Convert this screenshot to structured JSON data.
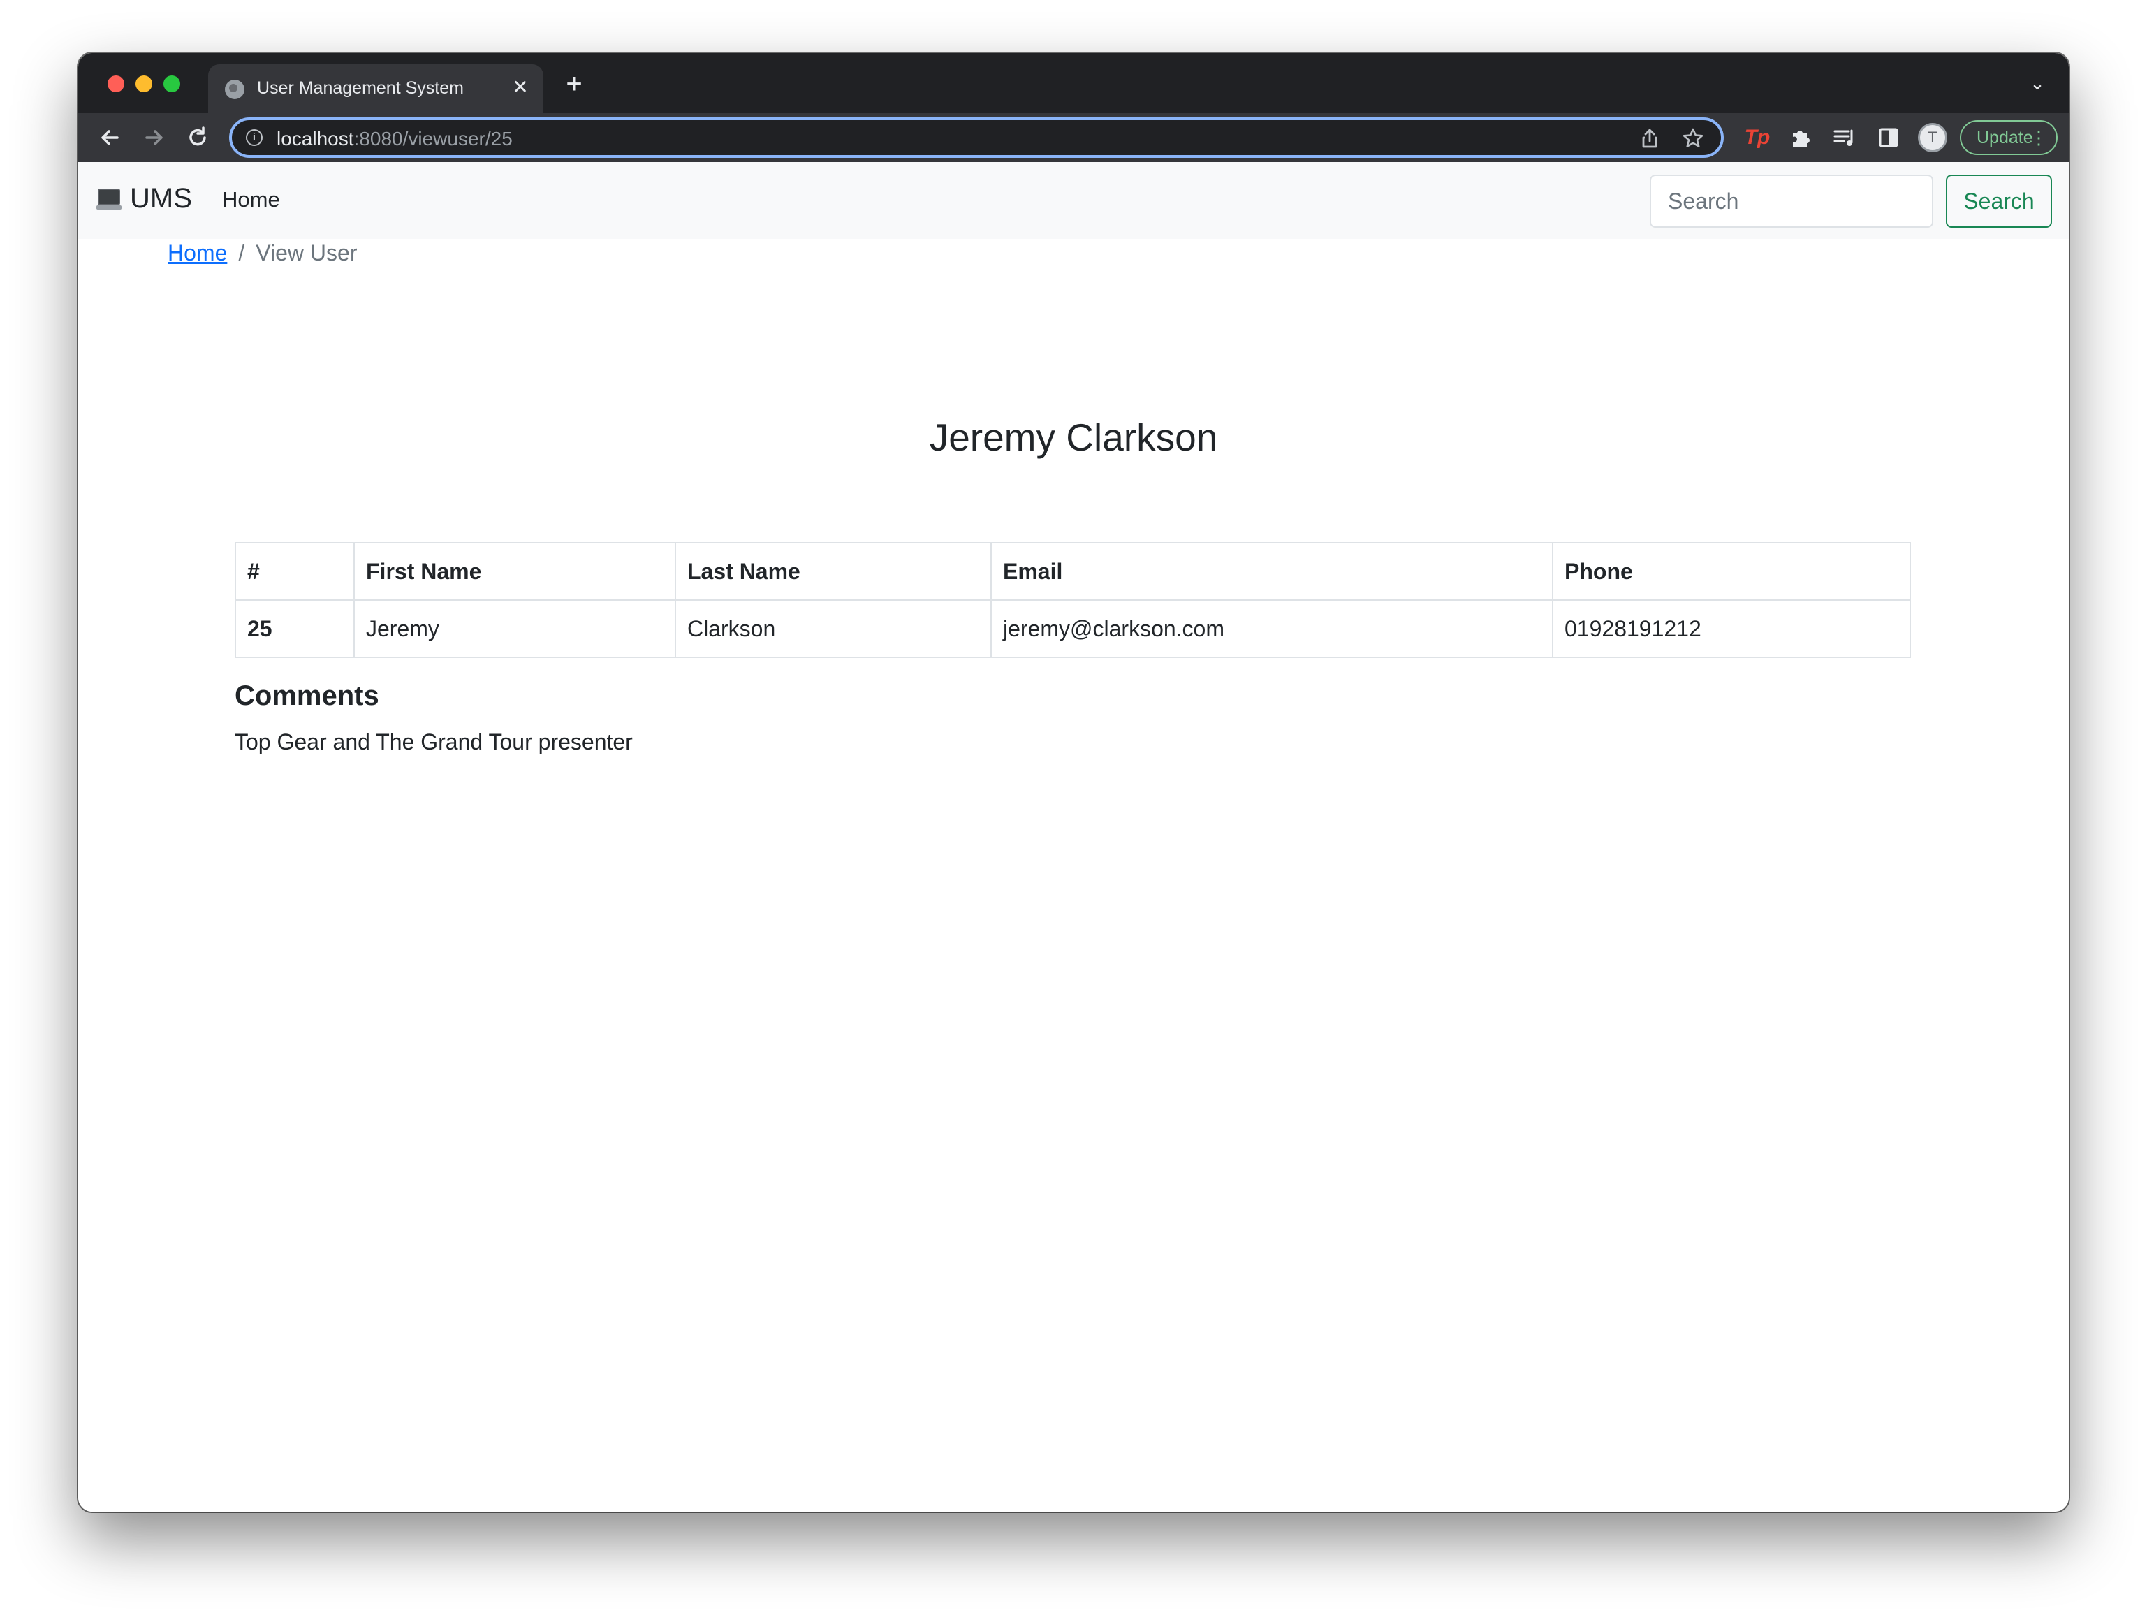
{
  "browser": {
    "tab_title": "User Management System",
    "tab_close": "✕",
    "new_tab": "+",
    "tab_menu": "⌄",
    "url_host": "localhost",
    "url_rest": ":8080/viewuser/25",
    "update_label": "Update",
    "profile_initial": "T",
    "icons": {
      "back": "arrow-left-icon",
      "forward": "arrow-right-icon",
      "reload": "reload-icon",
      "info": "info-icon",
      "share": "share-icon",
      "star": "star-icon",
      "extension_tp": "tp-extension-icon",
      "extensions": "puzzle-icon",
      "media": "media-control-icon",
      "side_panel": "side-panel-icon"
    }
  },
  "navbar": {
    "brand": "UMS",
    "home_link": "Home",
    "search_placeholder": "Search",
    "search_button": "Search"
  },
  "breadcrumb": {
    "home": "Home",
    "separator": "/",
    "current": "View User"
  },
  "user": {
    "title": "Jeremy Clarkson",
    "table": {
      "headers": [
        "#",
        "First Name",
        "Last Name",
        "Email",
        "Phone"
      ],
      "row": [
        "25",
        "Jeremy",
        "Clarkson",
        "jeremy@clarkson.com",
        "01928191212"
      ]
    },
    "comments_heading": "Comments",
    "comments_text": "Top Gear and The Grand Tour presenter"
  },
  "colors": {
    "accent_success": "#198754",
    "link": "#0d6efd",
    "browser_chrome": "#202124",
    "omnibox_focus": "#8ab4f8"
  }
}
